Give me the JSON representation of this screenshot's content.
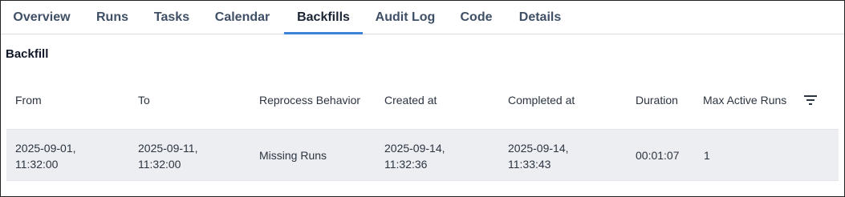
{
  "tabs": [
    {
      "label": "Overview"
    },
    {
      "label": "Runs"
    },
    {
      "label": "Tasks"
    },
    {
      "label": "Calendar"
    },
    {
      "label": "Backfills",
      "active": true
    },
    {
      "label": "Audit Log"
    },
    {
      "label": "Code"
    },
    {
      "label": "Details"
    }
  ],
  "section_title": "Backfill",
  "table": {
    "headers": {
      "from": "From",
      "to": "To",
      "reprocess": "Reprocess Behavior",
      "created": "Created at",
      "completed": "Completed at",
      "duration": "Duration",
      "max_active": "Max Active Runs"
    },
    "filter_icon": "filter-lines-icon",
    "rows": [
      {
        "from_date": "2025-09-01,",
        "from_time": "11:32:00",
        "to_date": "2025-09-11,",
        "to_time": "11:32:00",
        "reprocess": "Missing Runs",
        "created_date": "2025-09-14,",
        "created_time": "11:32:36",
        "completed_date": "2025-09-14,",
        "completed_time": "11:33:43",
        "duration": "00:01:07",
        "max_active": "1"
      }
    ]
  },
  "colors": {
    "active_tab_underline": "#3c82d8",
    "tab_text": "#3e4f66",
    "row_background": "#edeef2"
  }
}
